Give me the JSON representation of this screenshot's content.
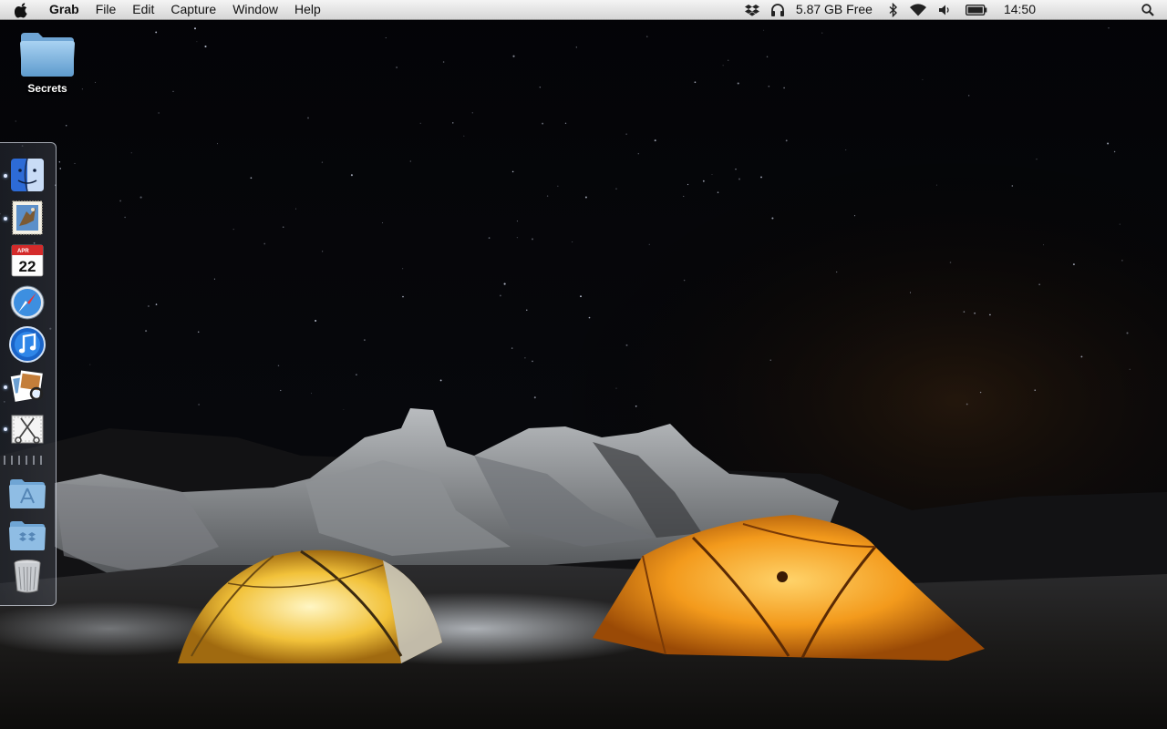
{
  "menubar": {
    "app_name": "Grab",
    "menus": [
      "File",
      "Edit",
      "Capture",
      "Window",
      "Help"
    ],
    "status": {
      "icons": [
        "dropbox-icon",
        "headphones-icon",
        "bluetooth-icon",
        "wifi-icon",
        "volume-icon",
        "battery-icon",
        "spotlight-icon"
      ],
      "disk_free": "5.87 GB Free",
      "clock": "14:50"
    }
  },
  "desktop": {
    "folder_label": "Secrets"
  },
  "dock": {
    "apps": [
      {
        "name": "Finder",
        "icon": "finder-icon",
        "running": true
      },
      {
        "name": "Mail",
        "icon": "mail-icon",
        "running": true
      },
      {
        "name": "iCal",
        "icon": "calendar-icon",
        "running": false,
        "date": "22",
        "month": "APR"
      },
      {
        "name": "Safari",
        "icon": "compass-icon",
        "running": false
      },
      {
        "name": "iTunes",
        "icon": "music-note-icon",
        "running": false
      },
      {
        "name": "Preview",
        "icon": "preview-icon",
        "running": true
      },
      {
        "name": "Grab",
        "icon": "scissors-icon",
        "running": true
      }
    ],
    "stacks": [
      {
        "name": "Applications",
        "icon": "applications-folder-icon"
      },
      {
        "name": "Dropbox",
        "icon": "dropbox-folder-icon"
      },
      {
        "name": "Trash",
        "icon": "trash-icon"
      }
    ]
  },
  "colors": {
    "menubar_bg": "#e6e6e6",
    "tent_left": "#f2c23a",
    "tent_right": "#f39a1c",
    "sky": "#05060a"
  }
}
